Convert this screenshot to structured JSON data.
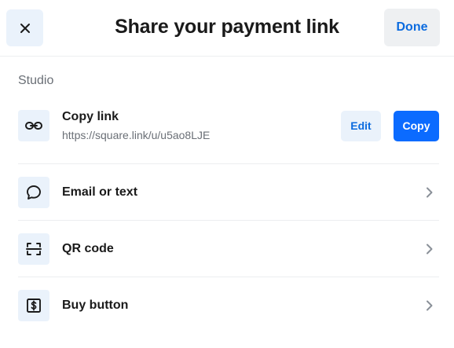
{
  "header": {
    "title": "Share your payment link",
    "done_label": "Done",
    "close_icon": "close-icon"
  },
  "section": {
    "label": "Studio"
  },
  "copy_link": {
    "title": "Copy link",
    "url": "https://square.link/u/u5ao8LJE",
    "edit_label": "Edit",
    "copy_label": "Copy",
    "icon": "link-icon"
  },
  "options": [
    {
      "label": "Email or text",
      "icon": "chat-bubble-icon"
    },
    {
      "label": "QR code",
      "icon": "qr-scan-icon"
    },
    {
      "label": "Buy button",
      "icon": "dollar-button-icon"
    }
  ],
  "colors": {
    "accent": "#0b6bff",
    "accent_text": "#0b6bdf",
    "icon_bg": "#eaf2fb",
    "done_bg": "#eef0f2",
    "divider": "#eceef0",
    "muted_text": "#6a6f76"
  }
}
